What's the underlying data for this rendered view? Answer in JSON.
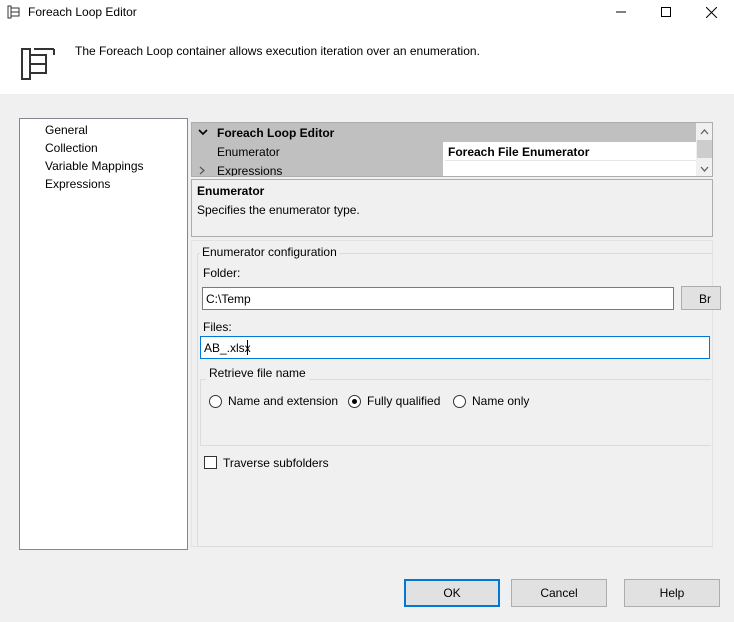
{
  "window": {
    "title": "Foreach Loop Editor",
    "controls": [
      "minimize-icon",
      "maximize-icon",
      "close-icon"
    ]
  },
  "header": {
    "icon": "foreach-container-icon",
    "description": "The Foreach Loop container allows execution iteration over an enumeration."
  },
  "nav": {
    "items": [
      {
        "label": "General",
        "selected": false
      },
      {
        "label": "Collection",
        "selected": true
      },
      {
        "label": "Variable Mappings",
        "selected": false
      },
      {
        "label": "Expressions",
        "selected": false
      }
    ]
  },
  "property_grid": {
    "category": "Foreach Loop Editor",
    "rows": [
      {
        "name": "Enumerator",
        "value": "Foreach File Enumerator"
      },
      {
        "name": "Expressions",
        "value": ""
      }
    ]
  },
  "description_box": {
    "title": "Enumerator",
    "text": "Specifies the enumerator type."
  },
  "config": {
    "group_label": "Enumerator configuration",
    "folder_label": "Folder:",
    "folder_value": "C:\\Temp",
    "browse_label": "Br",
    "files_label": "Files:",
    "files_value": "AB_.xlsx",
    "retrieve_label": "Retrieve file name",
    "retrieve_options": [
      {
        "label": "Name and extension",
        "checked": false
      },
      {
        "label": "Fully qualified",
        "checked": true
      },
      {
        "label": "Name only",
        "checked": false
      }
    ],
    "traverse_label": "Traverse subfolders",
    "traverse_checked": false
  },
  "buttons": {
    "ok": "OK",
    "cancel": "Cancel",
    "help": "Help"
  },
  "colors": {
    "accent": "#0078d7",
    "grid_category": "#c0c0c0",
    "background": "#f0f0f0"
  }
}
